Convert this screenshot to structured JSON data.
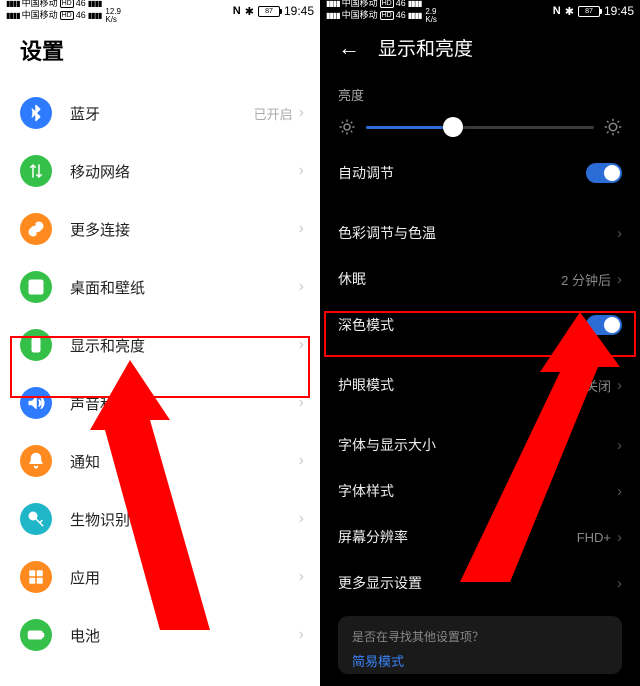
{
  "left": {
    "status": {
      "carrier": "中国移动",
      "hd": "HD",
      "sig4g": "46",
      "netnum": "12.9",
      "netunit": "K/s",
      "nfc": "N",
      "bt": "✱",
      "batt": "87",
      "time": "19:45"
    },
    "title": "设置",
    "rows": [
      {
        "key": "bt",
        "label": "蓝牙",
        "value": "已开启",
        "icon": "bluetooth",
        "color": "#2f7bff"
      },
      {
        "key": "mobile",
        "label": "移动网络",
        "value": "",
        "icon": "mobile-data",
        "color": "#35c04a"
      },
      {
        "key": "more",
        "label": "更多连接",
        "value": "",
        "icon": "link",
        "color": "#ff8a1f"
      },
      {
        "key": "wall",
        "label": "桌面和壁纸",
        "value": "",
        "icon": "image",
        "color": "#35c04a"
      },
      {
        "key": "display",
        "label": "显示和亮度",
        "value": "",
        "icon": "phone",
        "color": "#35c04a"
      },
      {
        "key": "sound",
        "label": "声音和振",
        "value": "",
        "icon": "sound",
        "color": "#2f7bff"
      },
      {
        "key": "notify",
        "label": "通知",
        "value": "",
        "icon": "bell",
        "color": "#ff8a1f"
      },
      {
        "key": "bio",
        "label": "生物识别和密码",
        "value": "",
        "icon": "key",
        "color": "#1fb6c9"
      },
      {
        "key": "apps",
        "label": "应用",
        "value": "",
        "icon": "apps",
        "color": "#ff8a1f"
      },
      {
        "key": "battery",
        "label": "电池",
        "value": "",
        "icon": "battery",
        "color": "#35c04a"
      }
    ]
  },
  "right": {
    "status": {
      "carrier": "中国移动",
      "hd": "HD",
      "sig4g": "46",
      "netnum": "2.9",
      "netunit": "K/s",
      "nfc": "N",
      "bt": "✱",
      "batt": "87",
      "time": "19:45"
    },
    "header": "显示和亮度",
    "brightness_label": "亮度",
    "rows": [
      {
        "key": "auto",
        "label": "自动调节",
        "type": "toggle",
        "on": true
      },
      {
        "key": "color",
        "label": "色彩调节与色温",
        "type": "link",
        "value": ""
      },
      {
        "key": "sleep",
        "label": "休眠",
        "type": "link",
        "value": "2 分钟后"
      },
      {
        "key": "dark",
        "label": "深色模式",
        "type": "toggle",
        "on": true
      },
      {
        "key": "eye",
        "label": "护眼模式",
        "type": "link",
        "value": "已关闭"
      },
      {
        "key": "font",
        "label": "字体与显示大小",
        "type": "link",
        "value": ""
      },
      {
        "key": "style",
        "label": "字体样式",
        "type": "link",
        "value": ""
      },
      {
        "key": "res",
        "label": "屏幕分辨率",
        "type": "link",
        "value": "FHD+"
      },
      {
        "key": "more",
        "label": "更多显示设置",
        "type": "link",
        "value": ""
      }
    ],
    "tip_q": "是否在寻找其他设置项？",
    "tip_a": "简易模式"
  }
}
